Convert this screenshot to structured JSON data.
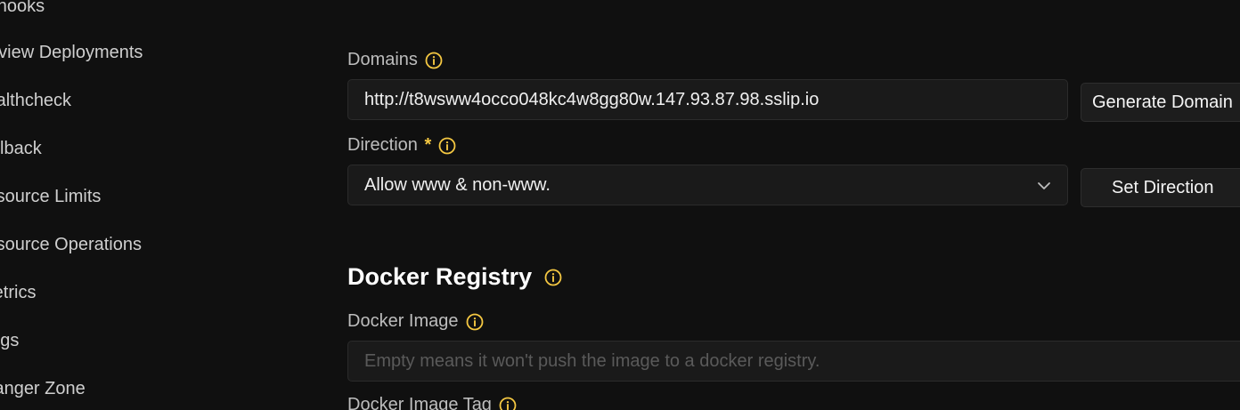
{
  "sidebar": {
    "items": [
      {
        "label": "Webhooks"
      },
      {
        "label": "Preview Deployments"
      },
      {
        "label": "Healthcheck"
      },
      {
        "label": "Rollback"
      },
      {
        "label": "Resource Limits"
      },
      {
        "label": "Resource Operations"
      },
      {
        "label": "Metrics"
      },
      {
        "label": "Logs"
      },
      {
        "label": "Danger Zone"
      }
    ]
  },
  "domains": {
    "label": "Domains",
    "value": "http://t8wsww4occo048kc4w8gg80w.147.93.87.98.sslip.io",
    "button": "Generate Domain"
  },
  "direction": {
    "label": "Direction",
    "required_mark": "*",
    "selected": "Allow www & non-www.",
    "button": "Set Direction"
  },
  "docker_registry": {
    "title": "Docker Registry",
    "image_label": "Docker Image",
    "image_placeholder": "Empty means it won't push the image to a docker registry.",
    "image_tag_label": "Docker Image Tag"
  },
  "colors": {
    "background": "#101010",
    "info_icon": "#f5c842",
    "input_bg": "#1a1a1a"
  },
  "icons": [
    "info-icon",
    "chevron-down-icon"
  ]
}
